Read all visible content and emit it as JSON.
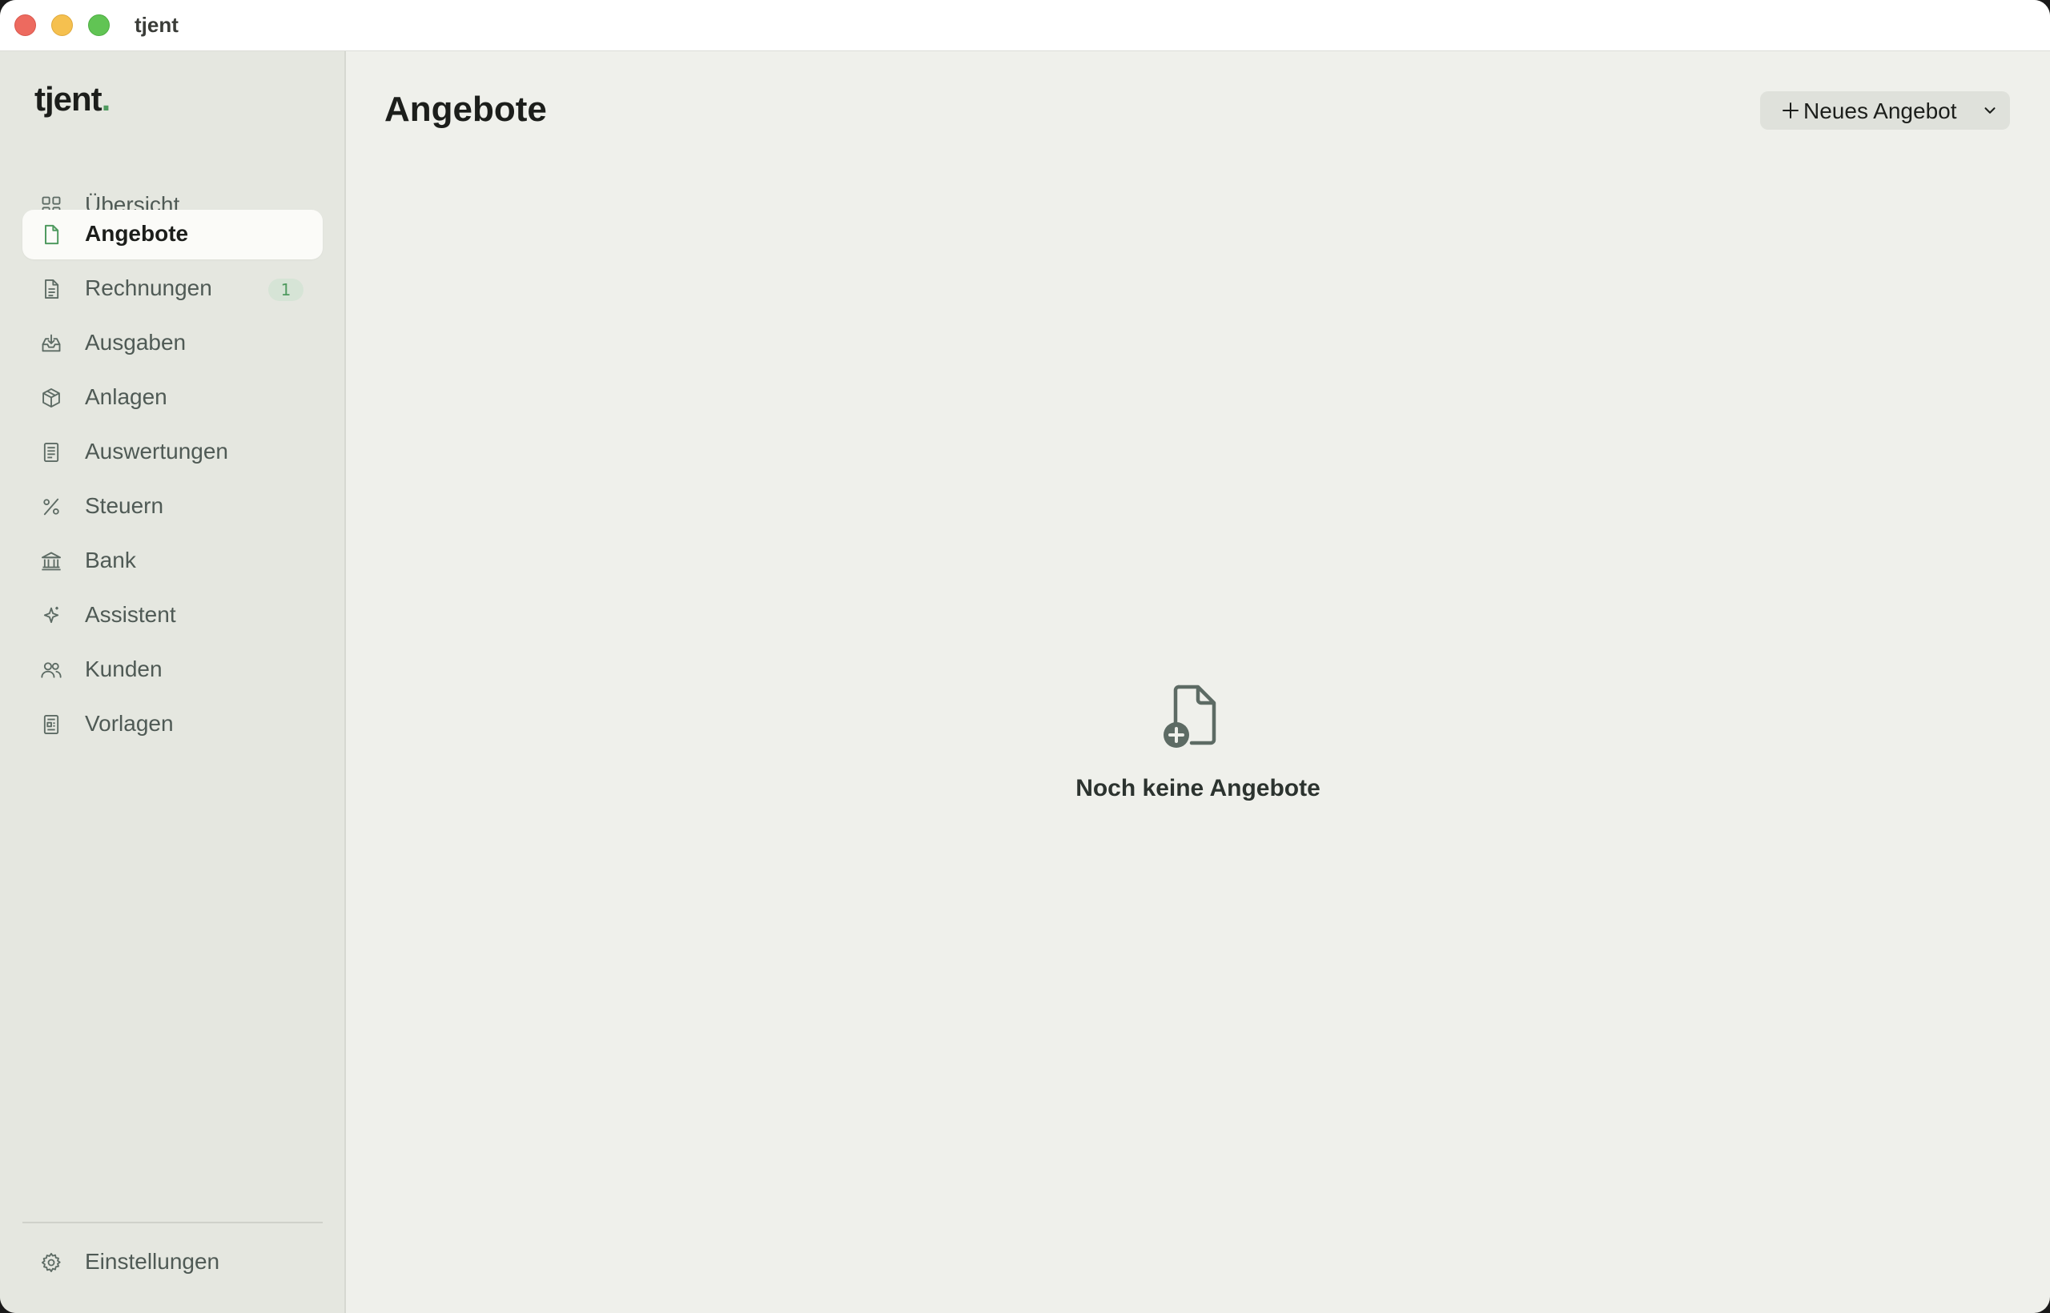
{
  "window": {
    "title": "tjent"
  },
  "sidebar": {
    "logo": "tjent",
    "logo_dot": ".",
    "items": [
      {
        "label": "Übersicht",
        "icon": "grid-icon"
      },
      {
        "label": "Angebote",
        "icon": "document-icon",
        "active": true
      },
      {
        "label": "Rechnungen",
        "icon": "invoice-icon",
        "badge": "1"
      },
      {
        "label": "Ausgaben",
        "icon": "inbox-download-icon"
      },
      {
        "label": "Anlagen",
        "icon": "box-icon"
      },
      {
        "label": "Auswertungen",
        "icon": "report-icon"
      },
      {
        "label": "Steuern",
        "icon": "percent-icon"
      },
      {
        "label": "Bank",
        "icon": "bank-icon"
      },
      {
        "label": "Assistent",
        "icon": "sparkle-icon"
      },
      {
        "label": "Kunden",
        "icon": "users-icon"
      },
      {
        "label": "Vorlagen",
        "icon": "template-icon"
      }
    ],
    "settings": {
      "label": "Einstellungen",
      "icon": "gear-icon"
    }
  },
  "main": {
    "title": "Angebote",
    "new_button": {
      "label": "Neues Angebot"
    },
    "empty_state": {
      "text": "Noch keine Angebote",
      "icon": "document-add-icon"
    }
  },
  "colors": {
    "accent": "#4f9a5f",
    "background": "#eff0eb",
    "sidebar": "#e5e7e0",
    "icon": "#5d6b64"
  }
}
